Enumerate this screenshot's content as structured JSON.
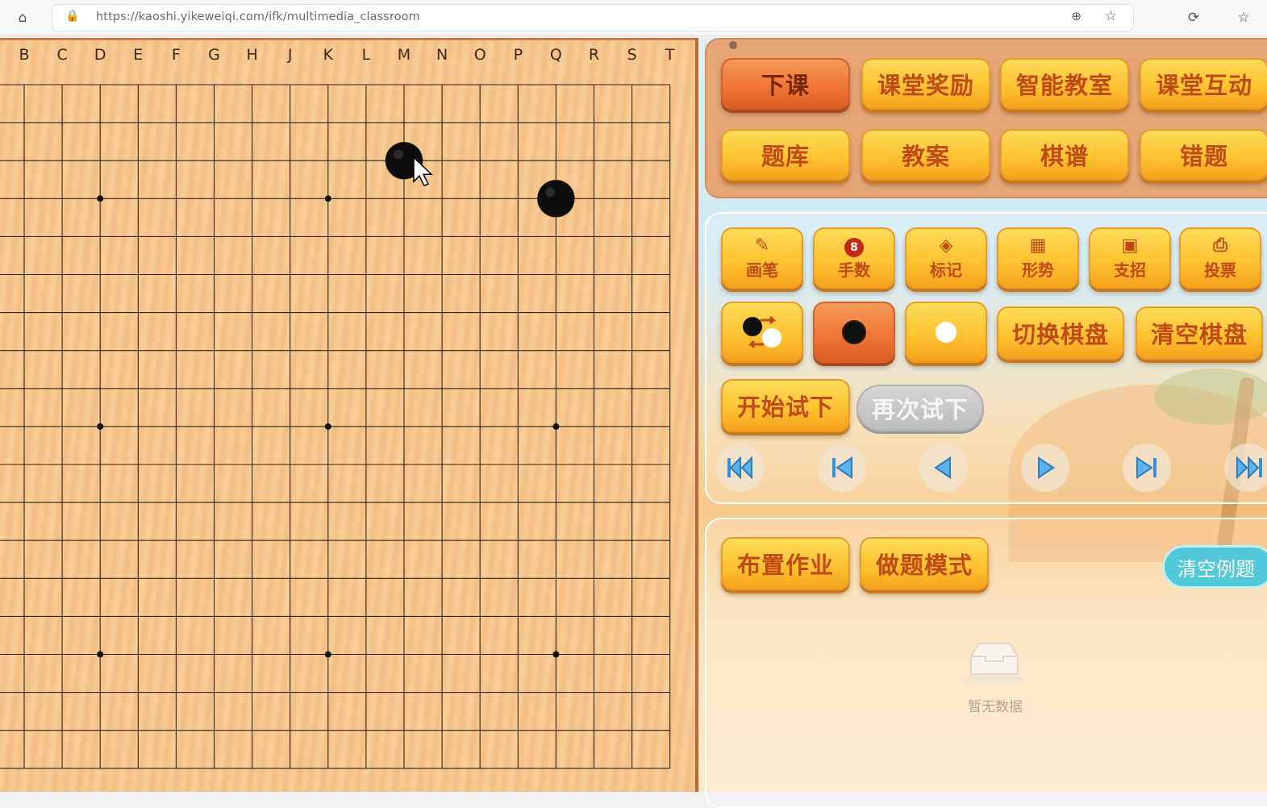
{
  "browser": {
    "url": "https://kaoshi.yikeweiqi.com/ifk/multimedia_classroom",
    "icons": [
      "home-icon",
      "lock-icon",
      "zoom-icon",
      "favorite-add-icon",
      "refresh-sync-icon",
      "favorites-icon"
    ]
  },
  "board": {
    "columns": [
      "B",
      "C",
      "D",
      "E",
      "F",
      "G",
      "H",
      "J",
      "K",
      "L",
      "M",
      "N",
      "O",
      "P",
      "Q",
      "R",
      "S",
      "T"
    ],
    "stones": [
      {
        "color": "black",
        "point": "M17"
      },
      {
        "color": "black",
        "point": "Q16"
      }
    ]
  },
  "top_buttons": {
    "end_class": "下课",
    "class_reward": "课堂奖励",
    "smart_classroom": "智能教室",
    "class_interaction": "课堂互动",
    "question_bank": "题库",
    "lesson_plan": "教案",
    "game_records": "棋谱",
    "wrong_questions": "错题"
  },
  "tools": {
    "pen": "画笔",
    "move_number": "手数",
    "mark": "标记",
    "situation": "形势",
    "hint": "支招",
    "vote": "投票",
    "switch_board": "切换棋盘",
    "clear_board": "清空棋盘",
    "start_trial": "开始试下",
    "retry_trial": "再次试下",
    "move_number_badge": "8"
  },
  "homework": {
    "assign": "布置作业",
    "practice_mode": "做题模式",
    "clear_examples": "清空例题",
    "empty_text": "暂无数据"
  },
  "colors": {
    "accent_orange": "#ffc331",
    "active_red": "#ee7636",
    "button_text": "#c04a15",
    "pill_cyan": "#52c9d8"
  }
}
